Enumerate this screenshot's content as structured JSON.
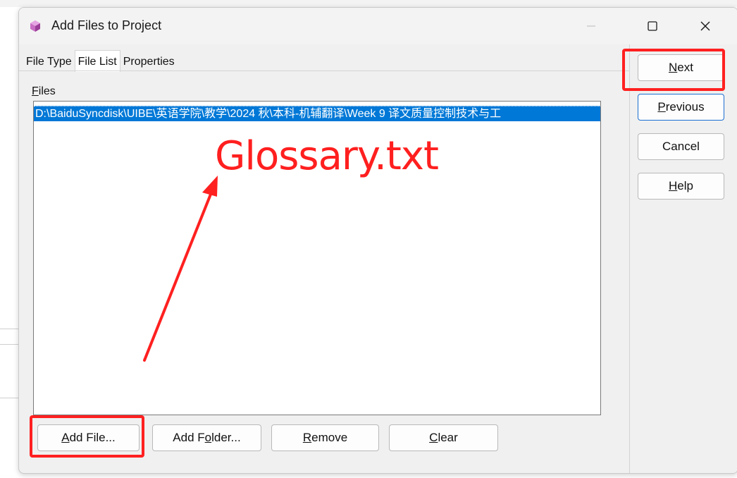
{
  "window": {
    "title": "Add Files to Project"
  },
  "tabs": [
    {
      "label": "File Type",
      "active": false
    },
    {
      "label": "File List",
      "active": true
    },
    {
      "label": "Properties",
      "active": false
    }
  ],
  "files": {
    "label_mnemonic": "F",
    "label_rest": "iles",
    "items": [
      "D:\\BaiduSyncdisk\\UIBE\\英语学院\\教学\\2024 秋\\本科-机辅翻译\\Week 9 译文质量控制技术与工"
    ],
    "selected_color": "#0078d7"
  },
  "buttons": {
    "add_file": {
      "mnemonic": "A",
      "rest": "dd File..."
    },
    "add_folder": {
      "pre": "Add F",
      "mnemonic": "o",
      "rest": "lder..."
    },
    "remove": {
      "mnemonic": "R",
      "rest": "emove"
    },
    "clear": {
      "mnemonic": "C",
      "rest": "lear"
    },
    "next": {
      "mnemonic": "N",
      "rest": "ext"
    },
    "previous": {
      "mnemonic": "P",
      "rest": "revious"
    },
    "cancel": {
      "label": "Cancel"
    },
    "help": {
      "mnemonic": "H",
      "rest": "elp"
    }
  },
  "annotation": {
    "text": "Glossary.txt",
    "color": "#ff1f1f"
  },
  "icons": {
    "app": "gem-cube-icon",
    "minimize": "minimize-icon",
    "maximize": "maximize-icon",
    "close": "close-icon"
  }
}
